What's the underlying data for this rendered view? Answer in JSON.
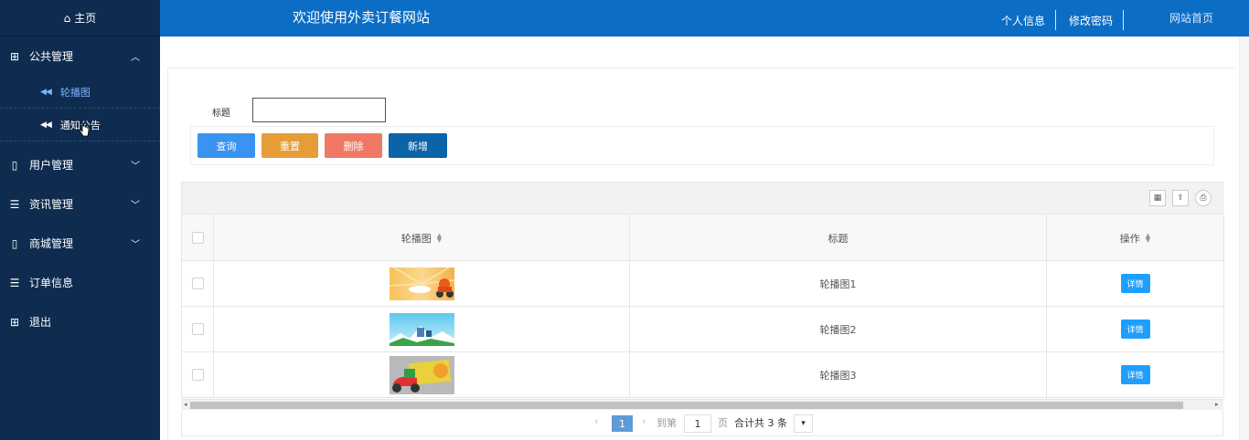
{
  "sidebar": {
    "home_label": "主页",
    "groups": [
      {
        "label": "公共管理",
        "icon": "grid-icon",
        "expanded": true,
        "items": [
          {
            "label": "轮播图",
            "active": true
          },
          {
            "label": "通知公告",
            "active": false
          }
        ]
      },
      {
        "label": "用户管理",
        "icon": "book-icon",
        "expanded": false
      },
      {
        "label": "资讯管理",
        "icon": "list-icon",
        "expanded": false
      },
      {
        "label": "商城管理",
        "icon": "book-icon",
        "expanded": false
      },
      {
        "label": "订单信息",
        "icon": "list-icon"
      },
      {
        "label": "退出",
        "icon": "grid-icon"
      }
    ]
  },
  "header": {
    "title": "欢迎使用外卖订餐网站",
    "links": [
      "个人信息",
      "修改密码",
      "网站首页"
    ]
  },
  "search": {
    "label": "标题",
    "value": ""
  },
  "buttons": {
    "query": "查询",
    "reset": "重置",
    "delete": "删除",
    "add": "新增"
  },
  "colors": {
    "query": "#3a93f0",
    "reset": "#e69d38",
    "delete": "#f17864",
    "add": "#0b63a8",
    "header": "#0c6dc5",
    "sidebar": "#0f2c50"
  },
  "table": {
    "columns": [
      "轮播图",
      "标题",
      "操作"
    ],
    "rows": [
      {
        "image": "banner-1-image",
        "title": "轮播图1",
        "action": "详情"
      },
      {
        "image": "banner-2-image",
        "title": "轮播图2",
        "action": "详情"
      },
      {
        "image": "banner-3-image",
        "title": "轮播图3",
        "action": "详情"
      }
    ]
  },
  "pager": {
    "current": "1",
    "goto_prefix": "到第",
    "goto_value": "1",
    "goto_suffix": "页",
    "total": "合计共 3 条"
  }
}
